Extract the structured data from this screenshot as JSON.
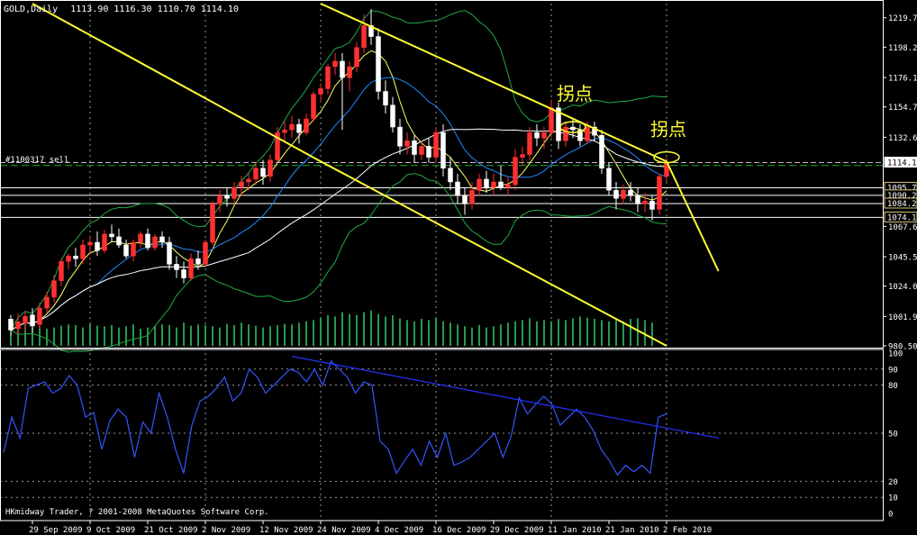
{
  "chart_data": {
    "type": "candlestick",
    "header": {
      "symbol": "GOLD,Daily",
      "ohlc": "1113.90 1116.30 1110.70 1114.10"
    },
    "price_axis": {
      "range": [
        980.5,
        1230.0
      ],
      "ticks": [
        "1219.70",
        "1198.25",
        "1176.15",
        "1154.70",
        "1132.60",
        "1067.60",
        "1045.50",
        "1024.05",
        "1001.95",
        "980.50"
      ],
      "level_labels": [
        "1114.10",
        "1095.76",
        "1090.24",
        "1084.25",
        "1074.11"
      ],
      "current_price": 1114.1
    },
    "date_axis": {
      "labels": [
        "29 Sep 2009",
        "9 Oct 2009",
        "21 Oct 2009",
        "2 Nov 2009",
        "12 Nov 2009",
        "24 Nov 2009",
        "4 Dec 2009",
        "16 Dec 2009",
        "29 Dec 2009",
        "11 Jan 2010",
        "21 Jan 2010",
        "2 Feb 2010"
      ]
    },
    "order_line": {
      "label": "#1100317 sell",
      "price": 1112.0
    },
    "annotations": [
      {
        "text": "拐点",
        "date": "14 Jan 2010"
      },
      {
        "text": "拐点",
        "date": "2 Feb 2010"
      }
    ],
    "oscillator": {
      "range": [
        0,
        100
      ],
      "ticks": [
        "100",
        "90",
        "80",
        "50",
        "20",
        "10",
        "0"
      ],
      "level_lines": [
        10,
        20,
        50,
        80,
        90
      ],
      "values": [
        38,
        60,
        47,
        78,
        80,
        82,
        75,
        78,
        86,
        80,
        60,
        63,
        40,
        58,
        65,
        60,
        35,
        57,
        50,
        75,
        60,
        40,
        25,
        55,
        70,
        73,
        78,
        85,
        70,
        75,
        90,
        85,
        75,
        80,
        85,
        90,
        88,
        82,
        90,
        80,
        95,
        90,
        85,
        75,
        82,
        80,
        45,
        40,
        25,
        33,
        40,
        30,
        45,
        35,
        50,
        30,
        32,
        35,
        40,
        45,
        50,
        35,
        48,
        72,
        62,
        68,
        73,
        68,
        55,
        60,
        65,
        60,
        52,
        40,
        33,
        24,
        30,
        26,
        30,
        25,
        60,
        62
      ]
    },
    "fitted_lines": {
      "channel_upper": [
        [
          "24 Nov 2009",
          1230
        ],
        [
          "2 Feb 2010",
          1115
        ],
        [
          "12 Feb 2010",
          1035
        ]
      ],
      "channel_lower": [
        [
          "29 Sep 2009",
          1230
        ],
        [
          "24 Nov 2009",
          1115
        ],
        [
          "2 Feb 2010",
          980.5
        ]
      ],
      "oscillator_trend": [
        [
          "18 Nov 2009",
          98
        ],
        [
          "12 Feb 2010",
          47
        ]
      ]
    },
    "candles": [
      {
        "date": "24 Sep 2009",
        "o": 1000.0,
        "h": 1003.0,
        "l": 988.0,
        "c": 992.0
      },
      {
        "date": "25 Sep 2009",
        "o": 993.0,
        "h": 1004.0,
        "l": 989.0,
        "c": 998.0
      },
      {
        "date": "28 Sep 2009",
        "o": 997.0,
        "h": 1006.0,
        "l": 990.0,
        "c": 1002.0
      },
      {
        "date": "29 Sep 2009",
        "o": 1003.0,
        "h": 1008.0,
        "l": 990.0,
        "c": 995.0
      },
      {
        "date": "30 Sep 2009",
        "o": 996.0,
        "h": 1012.0,
        "l": 993.0,
        "c": 1008.0
      },
      {
        "date": "1 Oct 2009",
        "o": 1008.0,
        "h": 1020.0,
        "l": 1004.0,
        "c": 1016.0
      },
      {
        "date": "2 Oct 2009",
        "o": 1016.0,
        "h": 1032.0,
        "l": 1012.0,
        "c": 1028.0
      },
      {
        "date": "5 Oct 2009",
        "o": 1028.0,
        "h": 1044.0,
        "l": 1024.0,
        "c": 1042.0
      },
      {
        "date": "6 Oct 2009",
        "o": 1042.0,
        "h": 1048.0,
        "l": 1036.0,
        "c": 1046.0
      },
      {
        "date": "7 Oct 2009",
        "o": 1046.0,
        "h": 1052.0,
        "l": 1038.0,
        "c": 1044.0
      },
      {
        "date": "8 Oct 2009",
        "o": 1044.0,
        "h": 1058.0,
        "l": 1040.0,
        "c": 1054.0
      },
      {
        "date": "9 Oct 2009",
        "o": 1054.0,
        "h": 1060.0,
        "l": 1048.0,
        "c": 1056.0
      },
      {
        "date": "12 Oct 2009",
        "o": 1056.0,
        "h": 1064.0,
        "l": 1046.0,
        "c": 1050.0
      },
      {
        "date": "13 Oct 2009",
        "o": 1050.0,
        "h": 1065.0,
        "l": 1048.0,
        "c": 1062.0
      },
      {
        "date": "14 Oct 2009",
        "o": 1062.0,
        "h": 1069.0,
        "l": 1056.0,
        "c": 1060.0
      },
      {
        "date": "15 Oct 2009",
        "o": 1060.0,
        "h": 1066.0,
        "l": 1052.0,
        "c": 1054.0
      },
      {
        "date": "16 Oct 2009",
        "o": 1054.0,
        "h": 1058.0,
        "l": 1044.0,
        "c": 1046.0
      },
      {
        "date": "19 Oct 2009",
        "o": 1046.0,
        "h": 1058.0,
        "l": 1042.0,
        "c": 1056.0
      },
      {
        "date": "20 Oct 2009",
        "o": 1056.0,
        "h": 1064.0,
        "l": 1052.0,
        "c": 1062.0
      },
      {
        "date": "21 Oct 2009",
        "o": 1062.0,
        "h": 1066.0,
        "l": 1050.0,
        "c": 1052.0
      },
      {
        "date": "22 Oct 2009",
        "o": 1052.0,
        "h": 1062.0,
        "l": 1050.0,
        "c": 1060.0
      },
      {
        "date": "23 Oct 2009",
        "o": 1060.0,
        "h": 1064.0,
        "l": 1052.0,
        "c": 1056.0
      },
      {
        "date": "26 Oct 2009",
        "o": 1056.0,
        "h": 1060.0,
        "l": 1036.0,
        "c": 1040.0
      },
      {
        "date": "27 Oct 2009",
        "o": 1040.0,
        "h": 1046.0,
        "l": 1030.0,
        "c": 1036.0
      },
      {
        "date": "28 Oct 2009",
        "o": 1036.0,
        "h": 1042.0,
        "l": 1026.0,
        "c": 1030.0
      },
      {
        "date": "29 Oct 2009",
        "o": 1030.0,
        "h": 1048.0,
        "l": 1028.0,
        "c": 1044.0
      },
      {
        "date": "30 Oct 2009",
        "o": 1044.0,
        "h": 1050.0,
        "l": 1036.0,
        "c": 1040.0
      },
      {
        "date": "2 Nov 2009",
        "o": 1040.0,
        "h": 1058.0,
        "l": 1038.0,
        "c": 1056.0
      },
      {
        "date": "3 Nov 2009",
        "o": 1056.0,
        "h": 1086.0,
        "l": 1054.0,
        "c": 1084.0
      },
      {
        "date": "4 Nov 2009",
        "o": 1084.0,
        "h": 1094.0,
        "l": 1078.0,
        "c": 1090.0
      },
      {
        "date": "5 Nov 2009",
        "o": 1090.0,
        "h": 1096.0,
        "l": 1082.0,
        "c": 1088.0
      },
      {
        "date": "6 Nov 2009",
        "o": 1088.0,
        "h": 1100.0,
        "l": 1084.0,
        "c": 1096.0
      },
      {
        "date": "9 Nov 2009",
        "o": 1096.0,
        "h": 1104.0,
        "l": 1090.0,
        "c": 1100.0
      },
      {
        "date": "10 Nov 2009",
        "o": 1100.0,
        "h": 1106.0,
        "l": 1094.0,
        "c": 1102.0
      },
      {
        "date": "11 Nov 2009",
        "o": 1102.0,
        "h": 1114.0,
        "l": 1098.0,
        "c": 1110.0
      },
      {
        "date": "12 Nov 2009",
        "o": 1110.0,
        "h": 1116.0,
        "l": 1098.0,
        "c": 1104.0
      },
      {
        "date": "13 Nov 2009",
        "o": 1104.0,
        "h": 1120.0,
        "l": 1100.0,
        "c": 1116.0
      },
      {
        "date": "16 Nov 2009",
        "o": 1116.0,
        "h": 1140.0,
        "l": 1114.0,
        "c": 1136.0
      },
      {
        "date": "17 Nov 2009",
        "o": 1136.0,
        "h": 1144.0,
        "l": 1130.0,
        "c": 1138.0
      },
      {
        "date": "18 Nov 2009",
        "o": 1138.0,
        "h": 1148.0,
        "l": 1132.0,
        "c": 1142.0
      },
      {
        "date": "19 Nov 2009",
        "o": 1142.0,
        "h": 1146.0,
        "l": 1128.0,
        "c": 1136.0
      },
      {
        "date": "20 Nov 2009",
        "o": 1136.0,
        "h": 1150.0,
        "l": 1134.0,
        "c": 1146.0
      },
      {
        "date": "23 Nov 2009",
        "o": 1146.0,
        "h": 1166.0,
        "l": 1144.0,
        "c": 1164.0
      },
      {
        "date": "24 Nov 2009",
        "o": 1164.0,
        "h": 1172.0,
        "l": 1158.0,
        "c": 1168.0
      },
      {
        "date": "25 Nov 2009",
        "o": 1168.0,
        "h": 1186.0,
        "l": 1164.0,
        "c": 1184.0
      },
      {
        "date": "26 Nov 2009",
        "o": 1184.0,
        "h": 1194.0,
        "l": 1178.0,
        "c": 1188.0
      },
      {
        "date": "27 Nov 2009",
        "o": 1188.0,
        "h": 1194.0,
        "l": 1138.0,
        "c": 1176.0
      },
      {
        "date": "30 Nov 2009",
        "o": 1176.0,
        "h": 1188.0,
        "l": 1166.0,
        "c": 1184.0
      },
      {
        "date": "1 Dec 2009",
        "o": 1184.0,
        "h": 1202.0,
        "l": 1180.0,
        "c": 1198.0
      },
      {
        "date": "2 Dec 2009",
        "o": 1198.0,
        "h": 1222.0,
        "l": 1194.0,
        "c": 1214.0
      },
      {
        "date": "3 Dec 2009",
        "o": 1214.0,
        "h": 1226.0,
        "l": 1200.0,
        "c": 1206.0
      },
      {
        "date": "4 Dec 2009",
        "o": 1206.0,
        "h": 1212.0,
        "l": 1160.0,
        "c": 1166.0
      },
      {
        "date": "7 Dec 2009",
        "o": 1166.0,
        "h": 1174.0,
        "l": 1150.0,
        "c": 1156.0
      },
      {
        "date": "8 Dec 2009",
        "o": 1156.0,
        "h": 1162.0,
        "l": 1136.0,
        "c": 1140.0
      },
      {
        "date": "9 Dec 2009",
        "o": 1140.0,
        "h": 1146.0,
        "l": 1120.0,
        "c": 1126.0
      },
      {
        "date": "10 Dec 2009",
        "o": 1126.0,
        "h": 1136.0,
        "l": 1120.0,
        "c": 1130.0
      },
      {
        "date": "11 Dec 2009",
        "o": 1130.0,
        "h": 1134.0,
        "l": 1114.0,
        "c": 1120.0
      },
      {
        "date": "14 Dec 2009",
        "o": 1120.0,
        "h": 1130.0,
        "l": 1116.0,
        "c": 1126.0
      },
      {
        "date": "15 Dec 2009",
        "o": 1126.0,
        "h": 1132.0,
        "l": 1114.0,
        "c": 1118.0
      },
      {
        "date": "16 Dec 2009",
        "o": 1118.0,
        "h": 1140.0,
        "l": 1114.0,
        "c": 1136.0
      },
      {
        "date": "17 Dec 2009",
        "o": 1136.0,
        "h": 1142.0,
        "l": 1104.0,
        "c": 1110.0
      },
      {
        "date": "18 Dec 2009",
        "o": 1110.0,
        "h": 1118.0,
        "l": 1094.0,
        "c": 1100.0
      },
      {
        "date": "21 Dec 2009",
        "o": 1100.0,
        "h": 1106.0,
        "l": 1084.0,
        "c": 1090.0
      },
      {
        "date": "22 Dec 2009",
        "o": 1090.0,
        "h": 1096.0,
        "l": 1076.0,
        "c": 1084.0
      },
      {
        "date": "23 Dec 2009",
        "o": 1084.0,
        "h": 1100.0,
        "l": 1080.0,
        "c": 1094.0
      },
      {
        "date": "24 Dec 2009",
        "o": 1094.0,
        "h": 1106.0,
        "l": 1090.0,
        "c": 1102.0
      },
      {
        "date": "28 Dec 2009",
        "o": 1102.0,
        "h": 1108.0,
        "l": 1092.0,
        "c": 1096.0
      },
      {
        "date": "29 Dec 2009",
        "o": 1096.0,
        "h": 1106.0,
        "l": 1090.0,
        "c": 1100.0
      },
      {
        "date": "30 Dec 2009",
        "o": 1100.0,
        "h": 1112.0,
        "l": 1094.0,
        "c": 1096.0
      },
      {
        "date": "31 Dec 2009",
        "o": 1096.0,
        "h": 1104.0,
        "l": 1090.0,
        "c": 1098.0
      },
      {
        "date": "4 Jan 2010",
        "o": 1098.0,
        "h": 1124.0,
        "l": 1094.0,
        "c": 1118.0
      },
      {
        "date": "5 Jan 2010",
        "o": 1118.0,
        "h": 1126.0,
        "l": 1112.0,
        "c": 1120.0
      },
      {
        "date": "6 Jan 2010",
        "o": 1120.0,
        "h": 1140.0,
        "l": 1116.0,
        "c": 1136.0
      },
      {
        "date": "7 Jan 2010",
        "o": 1136.0,
        "h": 1142.0,
        "l": 1126.0,
        "c": 1132.0
      },
      {
        "date": "8 Jan 2010",
        "o": 1132.0,
        "h": 1140.0,
        "l": 1124.0,
        "c": 1136.0
      },
      {
        "date": "11 Jan 2010",
        "o": 1136.0,
        "h": 1160.0,
        "l": 1132.0,
        "c": 1154.0
      },
      {
        "date": "12 Jan 2010",
        "o": 1154.0,
        "h": 1158.0,
        "l": 1124.0,
        "c": 1130.0
      },
      {
        "date": "13 Jan 2010",
        "o": 1130.0,
        "h": 1144.0,
        "l": 1126.0,
        "c": 1140.0
      },
      {
        "date": "14 Jan 2010",
        "o": 1140.0,
        "h": 1146.0,
        "l": 1132.0,
        "c": 1138.0
      },
      {
        "date": "15 Jan 2010",
        "o": 1138.0,
        "h": 1142.0,
        "l": 1126.0,
        "c": 1130.0
      },
      {
        "date": "18 Jan 2010",
        "o": 1130.0,
        "h": 1144.0,
        "l": 1128.0,
        "c": 1140.0
      },
      {
        "date": "19 Jan 2010",
        "o": 1140.0,
        "h": 1144.0,
        "l": 1130.0,
        "c": 1134.0
      },
      {
        "date": "20 Jan 2010",
        "o": 1134.0,
        "h": 1138.0,
        "l": 1106.0,
        "c": 1110.0
      },
      {
        "date": "21 Jan 2010",
        "o": 1110.0,
        "h": 1114.0,
        "l": 1090.0,
        "c": 1094.0
      },
      {
        "date": "22 Jan 2010",
        "o": 1094.0,
        "h": 1100.0,
        "l": 1080.0,
        "c": 1088.0
      },
      {
        "date": "25 Jan 2010",
        "o": 1088.0,
        "h": 1098.0,
        "l": 1084.0,
        "c": 1094.0
      },
      {
        "date": "26 Jan 2010",
        "o": 1094.0,
        "h": 1100.0,
        "l": 1086.0,
        "c": 1090.0
      },
      {
        "date": "27 Jan 2010",
        "o": 1090.0,
        "h": 1096.0,
        "l": 1078.0,
        "c": 1084.0
      },
      {
        "date": "28 Jan 2010",
        "o": 1084.0,
        "h": 1092.0,
        "l": 1078.0,
        "c": 1086.0
      },
      {
        "date": "29 Jan 2010",
        "o": 1086.0,
        "h": 1090.0,
        "l": 1072.0,
        "c": 1080.0
      },
      {
        "date": "1 Feb 2010",
        "o": 1080.0,
        "h": 1106.0,
        "l": 1076.0,
        "c": 1104.0
      },
      {
        "date": "2 Feb 2010",
        "o": 1104.0,
        "h": 1118.0,
        "l": 1100.0,
        "c": 1114.0
      }
    ],
    "volumes": [
      22,
      30,
      35,
      30,
      32,
      28,
      30,
      33,
      35,
      34,
      30,
      36,
      33,
      32,
      34,
      30,
      32,
      35,
      28,
      30,
      32,
      35,
      34,
      30,
      38,
      33,
      35,
      34,
      32,
      30,
      36,
      34,
      38,
      35,
      33,
      30,
      32,
      34,
      36,
      35,
      38,
      40,
      42,
      45,
      50,
      48,
      55,
      52,
      50,
      55,
      58,
      52,
      48,
      50,
      45,
      42,
      40,
      44,
      42,
      46,
      40,
      38,
      35,
      32,
      30,
      34,
      30,
      32,
      35,
      38,
      40,
      42,
      45,
      40,
      42,
      40,
      44,
      42,
      45,
      48,
      46,
      44,
      42,
      40,
      42,
      40,
      44,
      45,
      42,
      38
    ]
  },
  "status": {
    "copyright": "HKmidway Trader, ? 2001-2008 MetaQuotes Software Corp."
  },
  "colors": {
    "background": "#000000",
    "bull": "#ff3030",
    "bear": "#ffffff",
    "channel": "#ffff33",
    "band": "#22aa44",
    "ma_fast": "#ffff66",
    "ma_mid": "#2288ff",
    "ma_slow": "#ffffff",
    "volume": "#33cc66",
    "oscillator": "#3355ff",
    "trend": "#2233ff",
    "grid": "#ffffff"
  }
}
